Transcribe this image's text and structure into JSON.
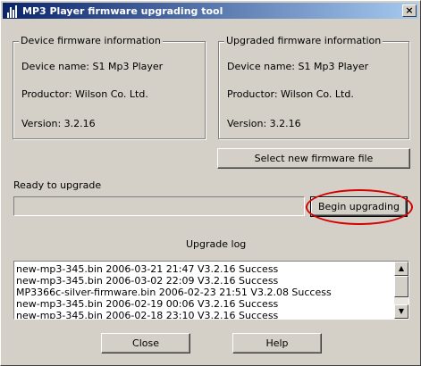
{
  "window": {
    "title": "MP3 Player firmware upgrading tool",
    "close_glyph": "×"
  },
  "device_info": {
    "legend": "Device firmware information",
    "device_name": "Device name: S1 Mp3 Player",
    "productor": "Productor: Wilson Co. Ltd.",
    "version": "Version: 3.2.16"
  },
  "upgraded_info": {
    "legend": "Upgraded firmware information",
    "device_name": "Device name: S1 Mp3 Player",
    "productor": "Productor: Wilson Co. Ltd.",
    "version": "Version: 3.2.16"
  },
  "actions": {
    "select_file_label": "Select new firmware file",
    "begin_upgrade_label": "Begin upgrading"
  },
  "status": {
    "text": "Ready to upgrade",
    "progress": 0
  },
  "log": {
    "title": "Upgrade log",
    "entries": [
      "new-mp3-345.bin  2006-03-21  21:47  V3.2.16  Success",
      "new-mp3-345.bin  2006-03-02  22:09  V3.2.16  Success",
      "MP3366c-silver-firmware.bin  2006-02-23  21:51  V3.2.08  Success",
      "new-mp3-345.bin  2006-02-19  00:06  V3.2.16  Success",
      "new-mp3-345.bin  2006-02-18  23:10  V3.2.16  Success"
    ]
  },
  "footer": {
    "close_label": "Close",
    "help_label": "Help"
  },
  "colors": {
    "title_bar_start": "#0a246a",
    "title_bar_end": "#a6caf0",
    "highlight_ring": "#d40000",
    "window_face": "#d4d0c8"
  },
  "icons": {
    "app": "bar-chart-icon",
    "close": "close-icon",
    "scroll_up": "scroll-up-arrow-icon",
    "scroll_down": "scroll-down-arrow-icon"
  }
}
